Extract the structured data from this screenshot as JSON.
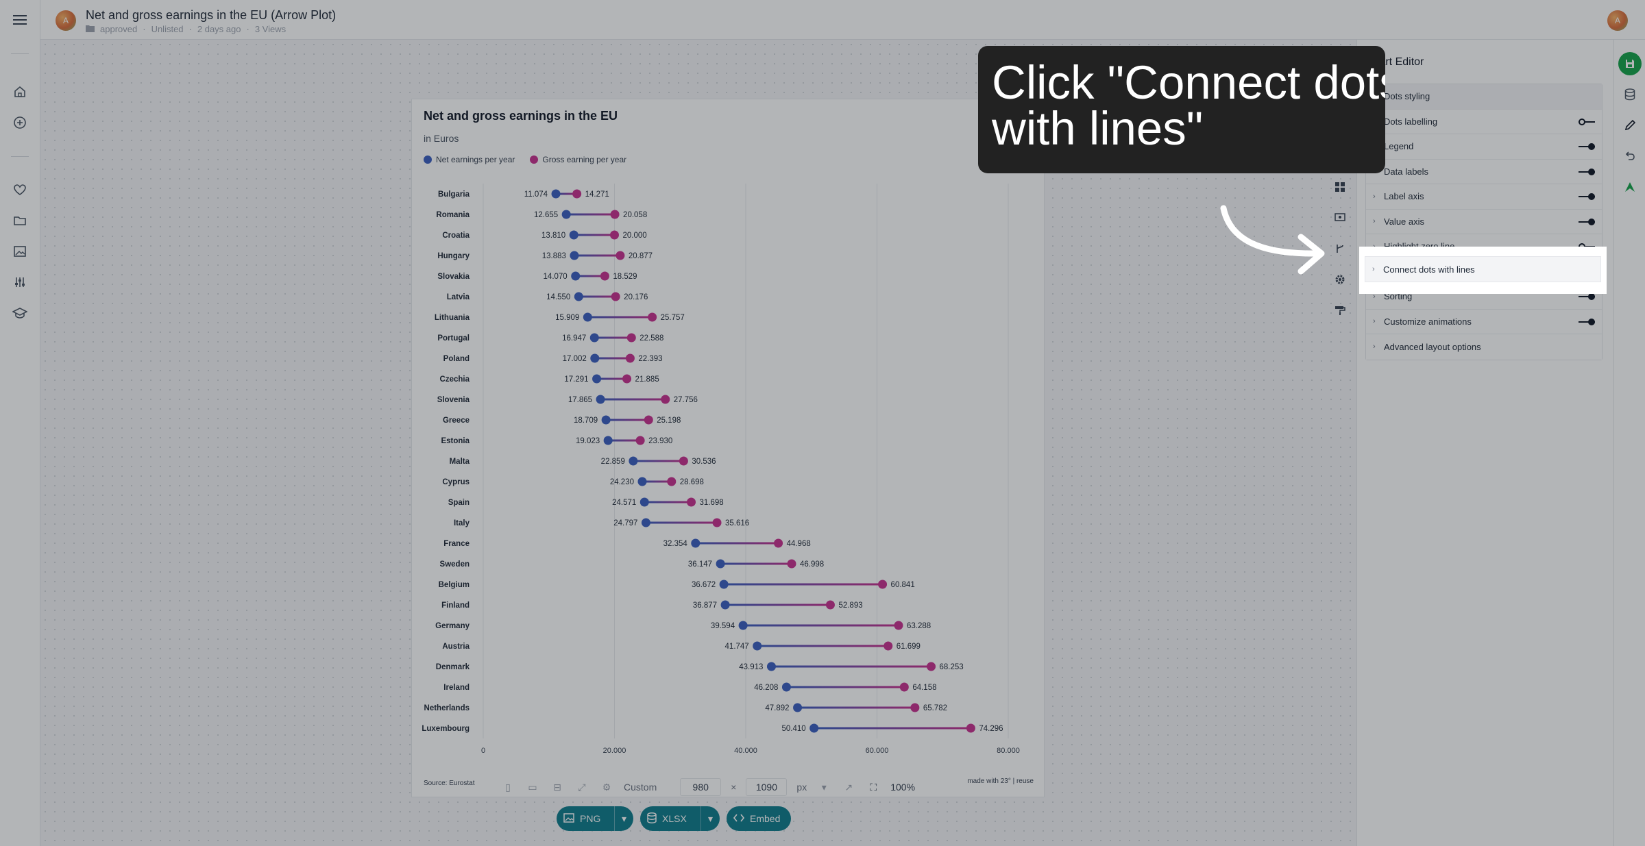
{
  "app": {
    "doc_title": "Net and gross earnings in the EU (Arrow Plot)",
    "avatar_initial": "A",
    "meta": [
      "approved",
      "Unlisted",
      "2 days ago",
      "3 Views"
    ]
  },
  "chart_data": {
    "type": "dot-range",
    "title": "Net and gross earnings in the EU",
    "subtitle": "in Euros",
    "series": [
      {
        "name": "Net earnings per year",
        "color": "#3b5fc0"
      },
      {
        "name": "Gross earning per year",
        "color": "#c8318f"
      }
    ],
    "categories": [
      "Bulgaria",
      "Romania",
      "Croatia",
      "Hungary",
      "Slovakia",
      "Latvia",
      "Lithuania",
      "Portugal",
      "Poland",
      "Czechia",
      "Slovenia",
      "Greece",
      "Estonia",
      "Malta",
      "Cyprus",
      "Spain",
      "Italy",
      "France",
      "Sweden",
      "Belgium",
      "Finland",
      "Germany",
      "Austria",
      "Denmark",
      "Ireland",
      "Netherlands",
      "Luxembourg"
    ],
    "net": [
      11074,
      12655,
      13810,
      13883,
      14070,
      14550,
      15909,
      16947,
      17002,
      17291,
      17865,
      18709,
      19023,
      22859,
      24230,
      24571,
      24797,
      32354,
      36147,
      36672,
      36877,
      39594,
      41747,
      43913,
      46208,
      47892,
      50410
    ],
    "gross": [
      14271,
      20058,
      20000,
      20877,
      18529,
      20176,
      25757,
      22588,
      22393,
      21885,
      27756,
      25198,
      23930,
      30536,
      28698,
      31698,
      35616,
      44968,
      46998,
      60841,
      52893,
      63288,
      61699,
      68253,
      64158,
      65782,
      74296
    ],
    "net_labels": [
      "11.074",
      "12.655",
      "13.810",
      "13.883",
      "14.070",
      "14.550",
      "15.909",
      "16.947",
      "17.002",
      "17.291",
      "17.865",
      "18.709",
      "19.023",
      "22.859",
      "24.230",
      "24.571",
      "24.797",
      "32.354",
      "36.147",
      "36.672",
      "36.877",
      "39.594",
      "41.747",
      "43.913",
      "46.208",
      "47.892",
      "50.410"
    ],
    "gross_labels": [
      "14.271",
      "20.058",
      "20.000",
      "20.877",
      "18.529",
      "20.176",
      "25.757",
      "22.588",
      "22.393",
      "21.885",
      "27.756",
      "25.198",
      "23.930",
      "30.536",
      "28.698",
      "31.698",
      "35.616",
      "44.968",
      "46.998",
      "60.841",
      "52.893",
      "63.288",
      "61.699",
      "68.253",
      "64.158",
      "65.782",
      "74.296"
    ],
    "x_ticks": [
      0,
      20000,
      40000,
      60000,
      80000
    ],
    "x_tick_labels": [
      "0",
      "20.000",
      "40.000",
      "60.000",
      "80.000"
    ],
    "xlim": [
      0,
      80000
    ],
    "grid": true,
    "legend": "top-left",
    "source": "Source: Eurostat",
    "made_with": "made with 23° | reuse"
  },
  "toolbar": {
    "preset": "Custom",
    "width": "980",
    "height": "1090",
    "times": "×",
    "unit": "px",
    "zoom": "100%"
  },
  "export": {
    "png": "PNG",
    "xlsx": "XLSX",
    "embed": "Embed"
  },
  "editor": {
    "title": "Chart Editor",
    "options": [
      {
        "label": "Dots styling",
        "toggle": "none"
      },
      {
        "label": "Dots labelling",
        "toggle": "off"
      },
      {
        "label": "Legend",
        "toggle": "on"
      },
      {
        "label": "Data labels",
        "toggle": "on"
      },
      {
        "label": "Label axis",
        "toggle": "on"
      },
      {
        "label": "Value axis",
        "toggle": "on"
      },
      {
        "label": "Highlight zero line",
        "toggle": "off"
      },
      {
        "label": "Connect dots with lines",
        "toggle": "none"
      },
      {
        "label": "Sorting",
        "toggle": "on"
      },
      {
        "label": "Customize animations",
        "toggle": "on"
      },
      {
        "label": "Advanced layout options",
        "toggle": "none"
      }
    ]
  },
  "callout": {
    "line1": "Click \"Connect dots",
    "line2": "with lines\""
  },
  "icons": {
    "menu": "menu-icon",
    "home": "home-icon",
    "add": "plus-circle-icon",
    "favorites": "heart-icon",
    "folders": "folder-icon",
    "images": "image-icon",
    "settings": "sliders-icon",
    "learn": "graduation-cap-icon"
  }
}
